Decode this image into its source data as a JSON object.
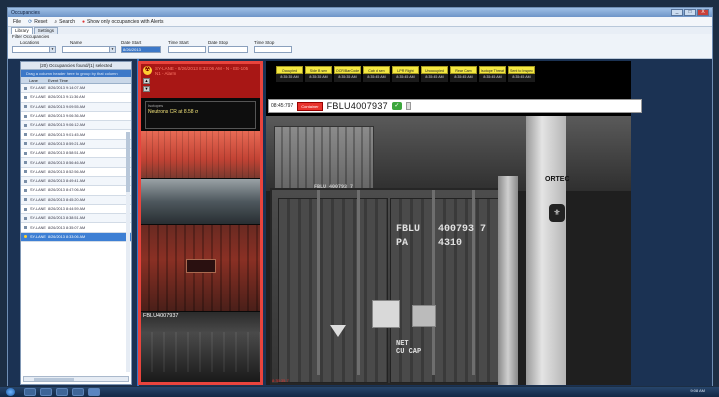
{
  "window": {
    "title": "Occupancies",
    "controls": [
      "_",
      "□",
      "X"
    ]
  },
  "toolbar": {
    "items": [
      {
        "label": "File",
        "icon": "file-icon"
      },
      {
        "label": "Reset",
        "icon": "reset-icon"
      },
      {
        "label": "Search",
        "icon": "search-icon"
      },
      {
        "label": "Show only occupancies with Alerts",
        "icon": "alert-icon"
      }
    ]
  },
  "tabs": [
    {
      "label": "Library",
      "active": true
    },
    {
      "label": "Settings",
      "active": false
    }
  ],
  "filters": {
    "section_label": "Filter Occupancies",
    "location_label": "Locations",
    "name_label": "Name",
    "date_start_label": "Date Start",
    "time_start_label": "Time Start",
    "date_stop_label": "Date Stop",
    "time_stop_label": "Time Stop",
    "date_start_value": "8/26/2013",
    "time_start_value": "",
    "date_stop_value": "",
    "time_stop_value": ""
  },
  "list": {
    "header": "(20) Occupancies found/(1) selected",
    "group_hint": "Drag a column header here to group by that column",
    "col_lane": "Lane",
    "col_time": "Event Time",
    "rows": [
      {
        "lane": "SY-LANE",
        "time": "8/26/2013 9:14:07 AM",
        "selected": false
      },
      {
        "lane": "SY-LANE",
        "time": "8/26/2013 9:11:36 AM",
        "selected": false
      },
      {
        "lane": "SY-LANE",
        "time": "8/26/2013 9:09:55 AM",
        "selected": false
      },
      {
        "lane": "SY-LANE",
        "time": "8/26/2013 9:06:36 AM",
        "selected": false
      },
      {
        "lane": "SY-LANE",
        "time": "8/26/2013 9:06:12 AM",
        "selected": false
      },
      {
        "lane": "SY-LANE",
        "time": "8/26/2013 9:01:45 AM",
        "selected": false
      },
      {
        "lane": "SY-LANE",
        "time": "8/26/2013 8:59:21 AM",
        "selected": false
      },
      {
        "lane": "SY-LANE",
        "time": "8/26/2013 8:58:51 AM",
        "selected": false
      },
      {
        "lane": "SY-LANE",
        "time": "8/26/2013 8:56:46 AM",
        "selected": false
      },
      {
        "lane": "SY-LANE",
        "time": "8/26/2013 8:52:56 AM",
        "selected": false
      },
      {
        "lane": "SY-LANE",
        "time": "8/26/2013 8:49:41 AM",
        "selected": false
      },
      {
        "lane": "SY-LANE",
        "time": "8/26/2013 8:47:06 AM",
        "selected": false
      },
      {
        "lane": "SY-LANE",
        "time": "8/26/2013 8:45:20 AM",
        "selected": false
      },
      {
        "lane": "SY-LANE",
        "time": "8/26/2013 8:44:59 AM",
        "selected": false
      },
      {
        "lane": "SY-LANE",
        "time": "8/26/2013 8:38:51 AM",
        "selected": false
      },
      {
        "lane": "SY-LANE",
        "time": "8/26/2013 8:35:07 AM",
        "selected": false
      },
      {
        "lane": "SY-LANE",
        "time": "8/26/2013 8:33:06 AM",
        "selected": true
      }
    ]
  },
  "alarm": {
    "text_line1": "SY-LANE - 8/26/2013 8:33:06 AM - N - EE-105",
    "text_line2": "N1 - Alarm",
    "isotope_header": "Isotopes",
    "isotope_value": "Neutrons CR at 8.58 σ",
    "btn_up": "▲",
    "btn_down": "▼",
    "image_label": "FBLU4007937"
  },
  "statuses": [
    {
      "label": "Occupied",
      "time": "8:35:35 AM"
    },
    {
      "label": "Side B sen",
      "time": "8:35:35 AM"
    },
    {
      "label": "OCR/BarCode",
      "time": "8:35:35 AM"
    },
    {
      "label": "Cab d sen",
      "time": "8:35:45 AM"
    },
    {
      "label": "LPR Right",
      "time": "8:35:45 AM"
    },
    {
      "label": "Unoccupied",
      "time": "8:35:45 AM"
    },
    {
      "label": "Rear Cam",
      "time": "8:35:45 AM"
    },
    {
      "label": "Isotope Threat",
      "time": "8:35:45 AM"
    },
    {
      "label": "Sent to Inspec",
      "time": "8:35:45 AM"
    }
  ],
  "container_bar": {
    "time": "08:45:797",
    "flag": "Container",
    "container_id": "FBLU4007937"
  },
  "scene": {
    "top_container_code": "FBLU 400793 7",
    "code_line1": "FBLU   400793 7",
    "code_line2": "PA     4310",
    "nt_text": "NET\nCU CAP",
    "brand": "ORTEC",
    "timestamp": "8:35:35.7"
  },
  "taskbar": {
    "clock": "9:08 AM"
  },
  "colors": {
    "accent": "#3c78c8",
    "alarm": "#e8443d",
    "status_yellow": "#f4e842"
  }
}
